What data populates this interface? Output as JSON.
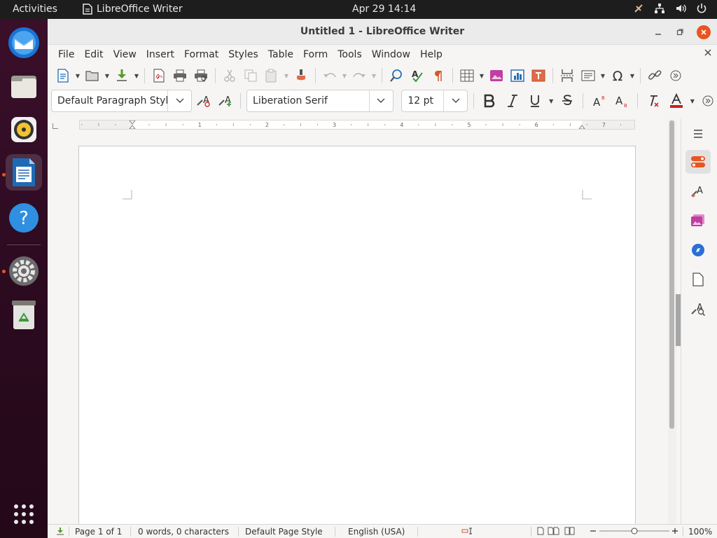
{
  "system": {
    "activities": "Activities",
    "app_name": "LibreOffice Writer",
    "clock": "Apr 29  14:14"
  },
  "window": {
    "title": "Untitled 1 - LibreOffice Writer"
  },
  "menubar": {
    "items": [
      "File",
      "Edit",
      "View",
      "Insert",
      "Format",
      "Styles",
      "Table",
      "Form",
      "Tools",
      "Window",
      "Help"
    ]
  },
  "formatting": {
    "paragraph_style": "Default Paragraph Styl",
    "font_name": "Liberation Serif",
    "font_size": "12 pt"
  },
  "statusbar": {
    "page": "Page 1 of 1",
    "words": "0 words, 0 characters",
    "page_style": "Default Page Style",
    "language": "English (USA)",
    "zoom": "100%"
  },
  "ruler": {
    "labels": [
      "1",
      "2",
      "3",
      "4",
      "5",
      "6",
      "7"
    ]
  },
  "colors": {
    "accent": "#e95420",
    "dock_bg": "#2c0a20",
    "topbar_bg": "#1d1d1d"
  }
}
